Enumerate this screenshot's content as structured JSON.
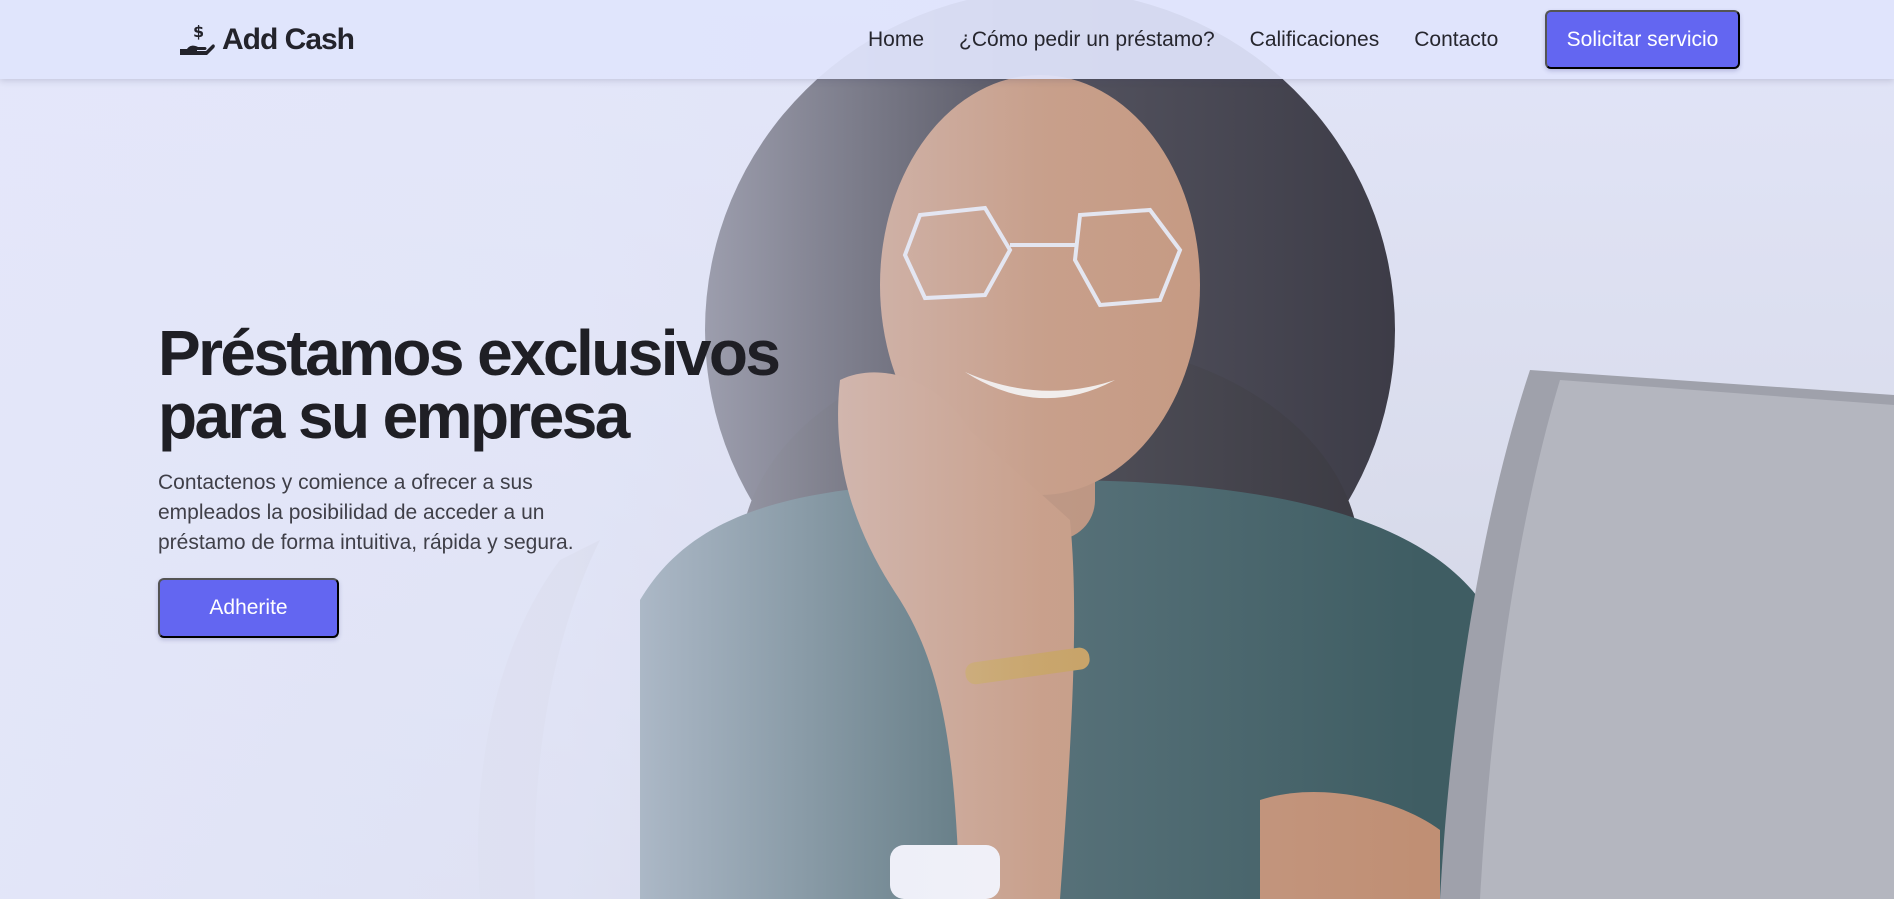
{
  "brand": {
    "name": "Add Cash",
    "icon": "hand-dollar-icon"
  },
  "nav": {
    "items": [
      {
        "label": "Home"
      },
      {
        "label": "¿Cómo pedir un préstamo?"
      },
      {
        "label": "Calificaciones"
      },
      {
        "label": "Contacto"
      }
    ],
    "cta_label": "Solicitar servicio"
  },
  "hero": {
    "title_line1": "Préstamos exclusivos",
    "title_line2": "para su empresa",
    "subtitle": "Contactenos y comience a ofrecer a sus empleados la posibilidad de acceder a un préstamo de forma intuitiva, rápida y segura.",
    "button_label": "Adherite",
    "image_subject": "smiling woman with curly hair and glasses at laptop"
  },
  "colors": {
    "accent": "#6366f1",
    "navbar_bg": "#e0e4fc",
    "text_dark": "#1f1f25",
    "text_body": "#3f3f48"
  }
}
